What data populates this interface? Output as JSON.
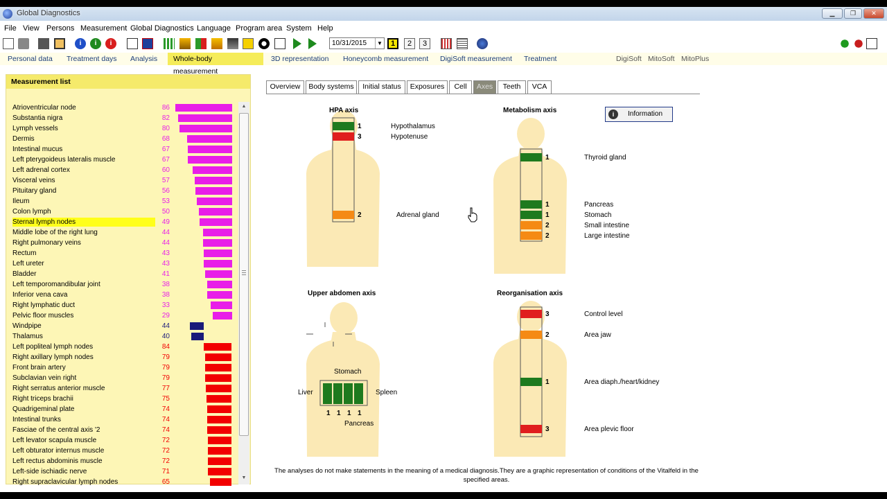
{
  "window": {
    "title": "Global Diagnostics"
  },
  "menu": [
    "File",
    "View",
    "Persons",
    "Measurement",
    "Global Diagnostics",
    "Language",
    "Program area",
    "System",
    "Help"
  ],
  "toolbar": {
    "date": "10/31/2015",
    "pages": [
      "1",
      "2",
      "3"
    ],
    "active_page": "1"
  },
  "nav_tabs": [
    {
      "label": "Personal data",
      "active": false
    },
    {
      "label": "Treatment days",
      "active": false
    },
    {
      "label": "Analysis",
      "active": false
    },
    {
      "label": "Whole-body measurement",
      "active": true
    },
    {
      "label": "3D representation",
      "active": false
    },
    {
      "label": "Honeycomb measurement",
      "active": false
    },
    {
      "label": "DigiSoft measurement",
      "active": false
    },
    {
      "label": "Treatment",
      "active": false
    }
  ],
  "nav_right": [
    "DigiSoft",
    "MitoSoft",
    "MitoPlus"
  ],
  "measurement_list": {
    "title": "Measurement list",
    "selected": "Sternal lymph nodes",
    "items": [
      {
        "name": "Atrioventricular node",
        "value": "86",
        "color": "magenta"
      },
      {
        "name": "Substantia nigra",
        "value": "82",
        "color": "magenta"
      },
      {
        "name": "Lymph vessels",
        "value": "80",
        "color": "magenta"
      },
      {
        "name": "Dermis",
        "value": "68",
        "color": "magenta"
      },
      {
        "name": "Intestinal mucus",
        "value": "67",
        "color": "magenta"
      },
      {
        "name": "Left pterygoideus lateralis muscle",
        "value": "67",
        "color": "magenta"
      },
      {
        "name": "Left adrenal cortex",
        "value": "60",
        "color": "magenta"
      },
      {
        "name": "Visceral veins",
        "value": "57",
        "color": "magenta"
      },
      {
        "name": "Pituitary gland",
        "value": "56",
        "color": "magenta"
      },
      {
        "name": "Ileum",
        "value": "53",
        "color": "magenta"
      },
      {
        "name": "Colon lymph",
        "value": "50",
        "color": "magenta"
      },
      {
        "name": "Sternal lymph nodes",
        "value": "49",
        "color": "magenta"
      },
      {
        "name": "Middle lobe of the right lung",
        "value": "44",
        "color": "magenta"
      },
      {
        "name": "Right pulmonary veins",
        "value": "44",
        "color": "magenta"
      },
      {
        "name": "Rectum",
        "value": "43",
        "color": "magenta"
      },
      {
        "name": "Left ureter",
        "value": "43",
        "color": "magenta"
      },
      {
        "name": "Bladder",
        "value": "41",
        "color": "magenta"
      },
      {
        "name": "Left temporomandibular joint",
        "value": "38",
        "color": "magenta"
      },
      {
        "name": "Inferior vena cava",
        "value": "38",
        "color": "magenta"
      },
      {
        "name": "Right lymphatic duct",
        "value": "33",
        "color": "magenta"
      },
      {
        "name": "Pelvic floor muscles",
        "value": "29",
        "color": "magenta"
      },
      {
        "name": "Windpipe",
        "value": "44",
        "color": "navy"
      },
      {
        "name": "Thalamus",
        "value": "40",
        "color": "navy"
      },
      {
        "name": "Left popliteal lymph nodes",
        "value": "84",
        "color": "red"
      },
      {
        "name": "Right axillary lymph nodes",
        "value": "79",
        "color": "red"
      },
      {
        "name": "Front brain artery",
        "value": "79",
        "color": "red"
      },
      {
        "name": "Subclavian vein right",
        "value": "79",
        "color": "red"
      },
      {
        "name": "Right serratus anterior muscle",
        "value": "77",
        "color": "red"
      },
      {
        "name": "Right triceps brachii",
        "value": "75",
        "color": "red"
      },
      {
        "name": "Quadrigeminal plate",
        "value": "74",
        "color": "red"
      },
      {
        "name": "Intestinal trunks",
        "value": "74",
        "color": "red"
      },
      {
        "name": "Fasciae of the central axis '2",
        "value": "74",
        "color": "red"
      },
      {
        "name": "Left levator scapula muscle",
        "value": "72",
        "color": "red"
      },
      {
        "name": "Left obturator internus muscle",
        "value": "72",
        "color": "red"
      },
      {
        "name": "Left rectus abdominis muscle",
        "value": "72",
        "color": "red"
      },
      {
        "name": "Left-side ischiadic nerve",
        "value": "71",
        "color": "red"
      },
      {
        "name": "Right supraclavicular lymph nodes",
        "value": "65",
        "color": "red"
      }
    ]
  },
  "sub_tabs": [
    {
      "label": "Overview",
      "active": false
    },
    {
      "label": "Body systems",
      "active": false
    },
    {
      "label": "Initial status",
      "active": false
    },
    {
      "label": "Exposures",
      "active": false
    },
    {
      "label": "Cell",
      "active": false
    },
    {
      "label": "Axes",
      "active": true
    },
    {
      "label": "Teeth",
      "active": false
    },
    {
      "label": "VCA",
      "active": false
    }
  ],
  "info_button": "Information",
  "colors": {
    "magenta": "#e81ee8",
    "navy": "#1a1a7a",
    "red": "#f20000",
    "green": "#1e7a1e",
    "orange": "#f58a14",
    "body": "#fbe9b5"
  },
  "axes": {
    "hpa": {
      "title": "HPA axis",
      "markers": [
        {
          "label": "Hypothalamus",
          "level": "1",
          "color": "green"
        },
        {
          "label": "Hypotenuse",
          "level": "3",
          "color": "red"
        },
        {
          "label": "Adrenal gland",
          "level": "2",
          "color": "orange"
        }
      ]
    },
    "metabolism": {
      "title": "Metabolism axis",
      "markers": [
        {
          "label": "Thyroid gland",
          "level": "1",
          "color": "green"
        },
        {
          "label": "Pancreas",
          "level": "1",
          "color": "green"
        },
        {
          "label": "Stomach",
          "level": "1",
          "color": "green"
        },
        {
          "label": "Small intestine",
          "level": "2",
          "color": "orange"
        },
        {
          "label": "Large intestine",
          "level": "2",
          "color": "orange"
        }
      ]
    },
    "upper_abdomen": {
      "title": "Upper abdomen axis",
      "labels": {
        "stomach": "Stomach",
        "liver": "Liver",
        "spleen": "Spleen",
        "pancreas": "Pancreas"
      },
      "levels": [
        "1",
        "1",
        "1",
        "1"
      ],
      "color": "green"
    },
    "reorganisation": {
      "title": "Reorganisation axis",
      "markers": [
        {
          "label": "Control level",
          "level": "3",
          "color": "red"
        },
        {
          "label": "Area jaw",
          "level": "2",
          "color": "orange"
        },
        {
          "label": "Area diaph./heart/kidney",
          "level": "1",
          "color": "green"
        },
        {
          "label": "Area plevic floor",
          "level": "3",
          "color": "red"
        }
      ]
    }
  },
  "disclaimer": "The analyses do not make statements in the meaning of a medical diagnosis.They are a graphic representation of conditions of the Vitalfeld in the specified areas."
}
